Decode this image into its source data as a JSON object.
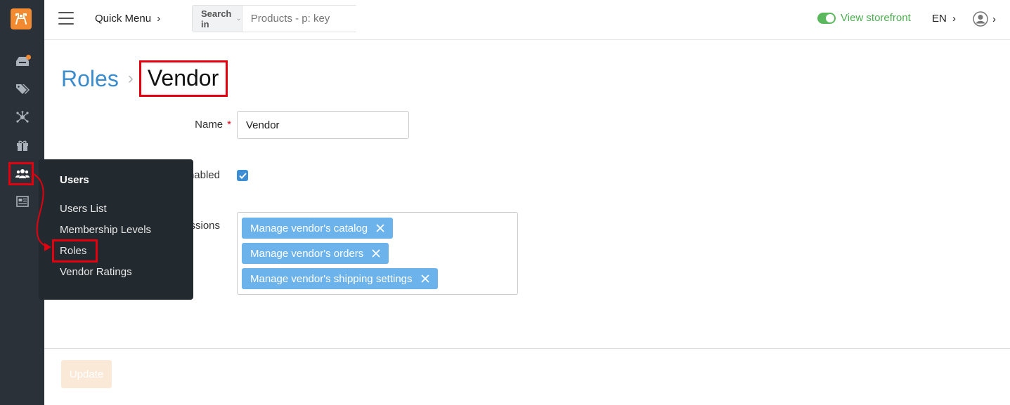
{
  "topbar": {
    "quick_menu_label": "Quick Menu",
    "search_in_label": "Search in",
    "search_placeholder": "Products - p: key",
    "storefront_label": "View storefront",
    "language": "EN"
  },
  "breadcrumb": {
    "parent": "Roles",
    "current": "Vendor"
  },
  "form": {
    "name_label": "Name",
    "name_required_mark": "*",
    "name_value": "Vendor",
    "enabled_label": "Enabled",
    "enabled_checked": true,
    "permissions_label": "Permissions",
    "permissions": [
      "Manage vendor's catalog",
      "Manage vendor's orders",
      "Manage vendor's shipping settings"
    ]
  },
  "footer": {
    "update_label": "Update"
  },
  "flyout": {
    "title": "Users",
    "items": [
      "Users List",
      "Membership Levels",
      "Roles",
      "Vendor Ratings"
    ],
    "highlighted": "Roles"
  },
  "sidebar": {
    "icons": [
      "orders-icon",
      "tag-icon",
      "network-icon",
      "gift-icon",
      "users-icon",
      "news-icon"
    ],
    "active": "users-icon"
  },
  "colors": {
    "sidebar_bg": "#2a3138",
    "accent_orange": "#f28a31",
    "link_blue": "#3a8ccc",
    "tag_blue": "#6cb2eb",
    "storefront_green": "#4caf50",
    "highlight_red": "#e3000f"
  }
}
